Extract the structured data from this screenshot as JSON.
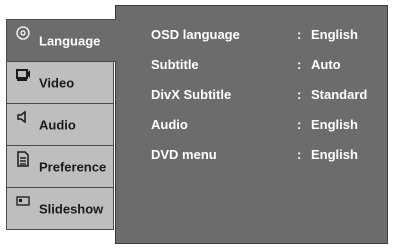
{
  "tabs": [
    {
      "label": "Language",
      "icon": "disc-icon",
      "active": true
    },
    {
      "label": "Video",
      "icon": "display-icon",
      "active": false
    },
    {
      "label": "Audio",
      "icon": "speaker-icon",
      "active": false
    },
    {
      "label": "Preference",
      "icon": "document-icon",
      "active": false
    },
    {
      "label": "Slideshow",
      "icon": "slideshow-icon",
      "active": false
    }
  ],
  "settings": [
    {
      "name": "OSD language",
      "value": "English"
    },
    {
      "name": "Subtitle",
      "value": "Auto"
    },
    {
      "name": "DivX Subtitle",
      "value": "Standard"
    },
    {
      "name": "Audio",
      "value": "English"
    },
    {
      "name": "DVD menu",
      "value": "English"
    }
  ],
  "separator": ":",
  "colors": {
    "panel": "#6b6c6e",
    "tab": "#bdbebf",
    "text_light": "#ffffff",
    "text_dark": "#1a1a1a"
  }
}
